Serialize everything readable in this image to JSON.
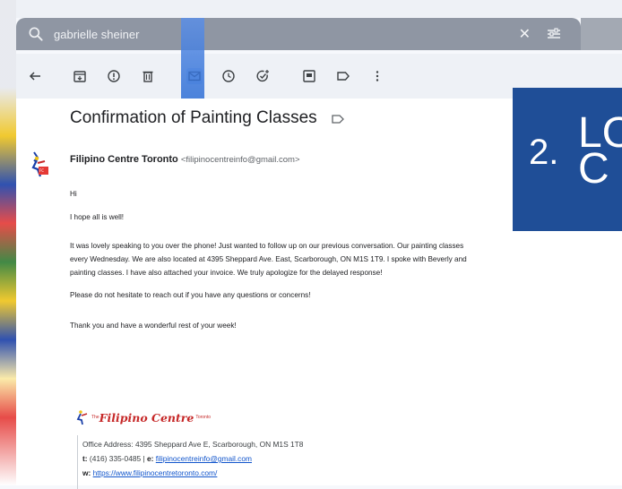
{
  "search": {
    "query": "gabrielle sheiner",
    "clear_glyph": "✕"
  },
  "toolbar": {
    "icons": [
      "back-arrow-icon",
      "archive-icon",
      "report-spam-icon",
      "delete-icon",
      "mark-unread-icon",
      "snooze-icon",
      "add-task-icon",
      "move-to-icon",
      "label-icon",
      "more-vert-icon"
    ]
  },
  "email": {
    "subject": "Confirmation of Painting Classes",
    "sender_name": "Filipino Centre Toronto",
    "sender_email": "<filipinocentreinfo@gmail.com>",
    "greeting": "Hi",
    "line1": "I hope all is well!",
    "body_line1": "It was lovely speaking to you over the phone! Just wanted to follow up on our previous conversation. Our painting classes",
    "body_line2": "every Wednesday.  We are also located at 4395 Sheppard Ave. East, Scarborough, ON M1S 1T9. I spoke with Beverly and",
    "body_line3": "painting classes. I have also attached your invoice. We truly apologize for the delayed response!",
    "line_questions": "Please do not hesitate to reach out if you have any questions or concerns!",
    "line_thanks": "Thank you and have a wonderful rest of your week!"
  },
  "signature": {
    "brand": "Filipino Centre",
    "brand_prefix": "The",
    "brand_suffix": "Toronto",
    "address": "Office Address: 4395 Sheppard Ave E, Scarborough, ON M1S 1T8",
    "t_label": "t:",
    "phone": "(416) 335-0485 |",
    "e_label": "e:",
    "email": "filipinocentreinfo@gmail.com",
    "w_label": "w:",
    "website": "https://www.filipinocentretoronto.com/"
  },
  "overlay": {
    "number": "2.",
    "line1": "LO",
    "line2": "C"
  },
  "colors": {
    "overlay_bg": "#1f4e97",
    "link": "#1155cc",
    "brand_red": "#c62828"
  }
}
